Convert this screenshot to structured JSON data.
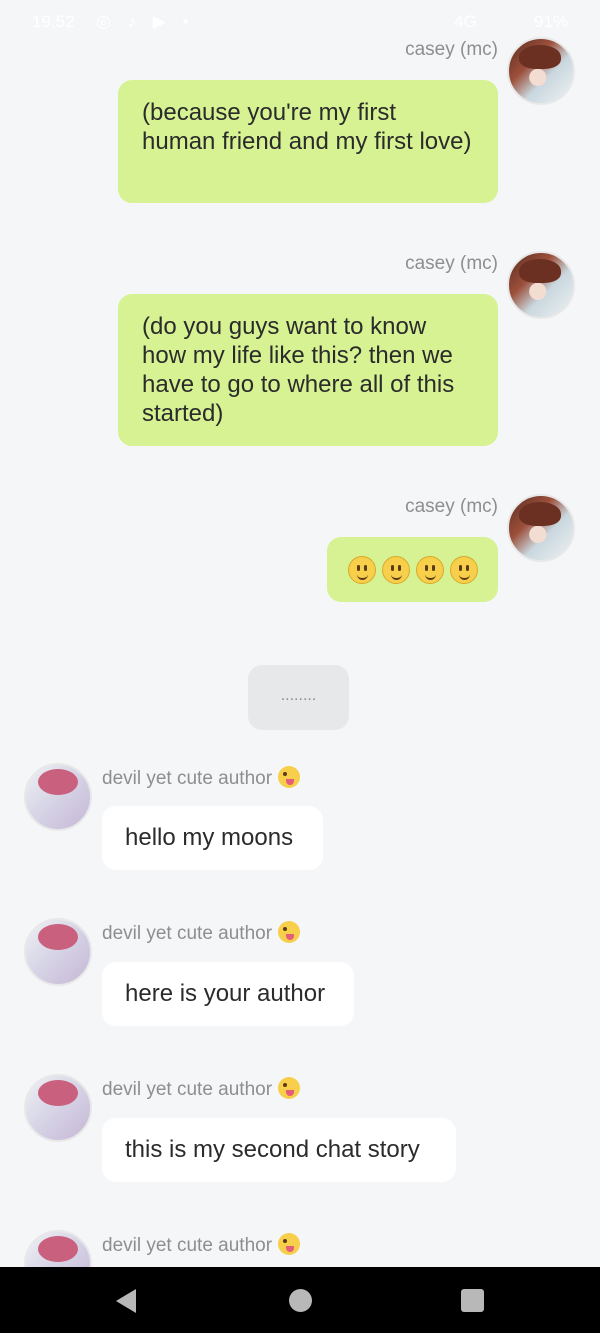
{
  "status_bar": {
    "time": "19.52",
    "network": "4G",
    "battery": "91%"
  },
  "messages": [
    {
      "sender": "casey (mc)",
      "text": "(because you're my first human friend and my first love)"
    },
    {
      "sender": "casey (mc)",
      "text": "(do you guys want to know how my life like this? then we have to go to where all of this started)"
    },
    {
      "sender": "casey (mc)",
      "emoji": "slightly-smiling-face",
      "count": 4
    },
    {
      "system_text": "........"
    },
    {
      "sender": "devil yet cute author",
      "text": "hello my moons"
    },
    {
      "sender": "devil yet cute author",
      "text": "here is your author"
    },
    {
      "sender": "devil yet cute author",
      "text": "this is my second chat story"
    },
    {
      "sender": "devil yet cute author"
    }
  ],
  "colors": {
    "background": "#f5f6f8",
    "mc_bubble": "#d6f293",
    "author_bubble": "#ffffff",
    "system_bubble": "#e7e8ea",
    "name_text": "#8e8e8e"
  },
  "icons": {
    "author_badge": "winking-face-with-tongue-icon",
    "nav": [
      "back-icon",
      "home-icon",
      "recent-apps-icon"
    ]
  }
}
